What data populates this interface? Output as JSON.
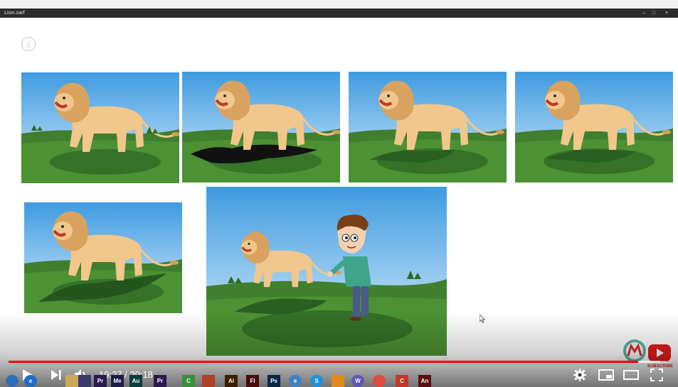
{
  "window": {
    "title": "Lion.swf",
    "controls": [
      "–",
      "□",
      "×"
    ]
  },
  "stage": {
    "info_icon": "info-icon",
    "info_glyph": "i"
  },
  "panels": [
    {
      "id": "lion-panel-1",
      "shadow": "soft"
    },
    {
      "id": "lion-panel-2",
      "shadow": "dark-lion-silhouette"
    },
    {
      "id": "lion-panel-3",
      "shadow": "soft-lion"
    },
    {
      "id": "lion-panel-4",
      "shadow": "soft-lion"
    },
    {
      "id": "lion-panel-5",
      "shadow": "long-lion"
    },
    {
      "id": "lion-boy-panel",
      "shadow": "soft",
      "has_boy": true
    }
  ],
  "overlay": {
    "subscribe_label": "SUBSCRIBE"
  },
  "player": {
    "current_time": "19:27",
    "duration": "20:18",
    "time_text": "19:27 / 20:18",
    "progress": 0.957,
    "buffered": 0.99,
    "colors": {
      "progress": "#ff0000",
      "accent": "#ffffff"
    }
  },
  "taskbar": {
    "items": [
      {
        "name": "start-orb-icon",
        "label": "",
        "color": "#2f6fb5"
      },
      {
        "name": "ie-icon",
        "label": "e",
        "color": "#1c6fc7"
      },
      {
        "name": "explorer-icon",
        "label": "",
        "color": "#c9a85a"
      },
      {
        "name": "media-player-icon",
        "label": "",
        "color": "#3b3b6e"
      },
      {
        "name": "premiere-icon",
        "label": "Pr",
        "color": "#2a1a4d"
      },
      {
        "name": "media-encoder-icon",
        "label": "Me",
        "color": "#1d1d4a"
      },
      {
        "name": "audition-icon",
        "label": "Au",
        "color": "#0b3d3a"
      },
      {
        "name": "premiere-alt-icon",
        "label": "Pr",
        "color": "#2a1a4d"
      },
      {
        "name": "camtasia-icon",
        "label": "C",
        "color": "#3a8f3a"
      },
      {
        "name": "windows-store-icon",
        "label": "",
        "color": "#b0402a"
      },
      {
        "name": "illustrator-icon",
        "label": "Ai",
        "color": "#3d1f00"
      },
      {
        "name": "flash-icon",
        "label": "Fl",
        "color": "#4a0b0b"
      },
      {
        "name": "photoshop-icon",
        "label": "Ps",
        "color": "#0b2845"
      },
      {
        "name": "edge-icon",
        "label": "e",
        "color": "#3f82c4"
      },
      {
        "name": "skype-icon",
        "label": "S",
        "color": "#1f8fd9"
      },
      {
        "name": "vlc-icon",
        "label": "",
        "color": "#e08a1d"
      },
      {
        "name": "word-icon",
        "label": "W",
        "color": "#5a5ab5"
      },
      {
        "name": "chrome-icon",
        "label": "",
        "color": "#dd4b39"
      },
      {
        "name": "camtasia-red-icon",
        "label": "C",
        "color": "#c0392b"
      },
      {
        "name": "animate-icon",
        "label": "An",
        "color": "#5a1010"
      }
    ]
  }
}
